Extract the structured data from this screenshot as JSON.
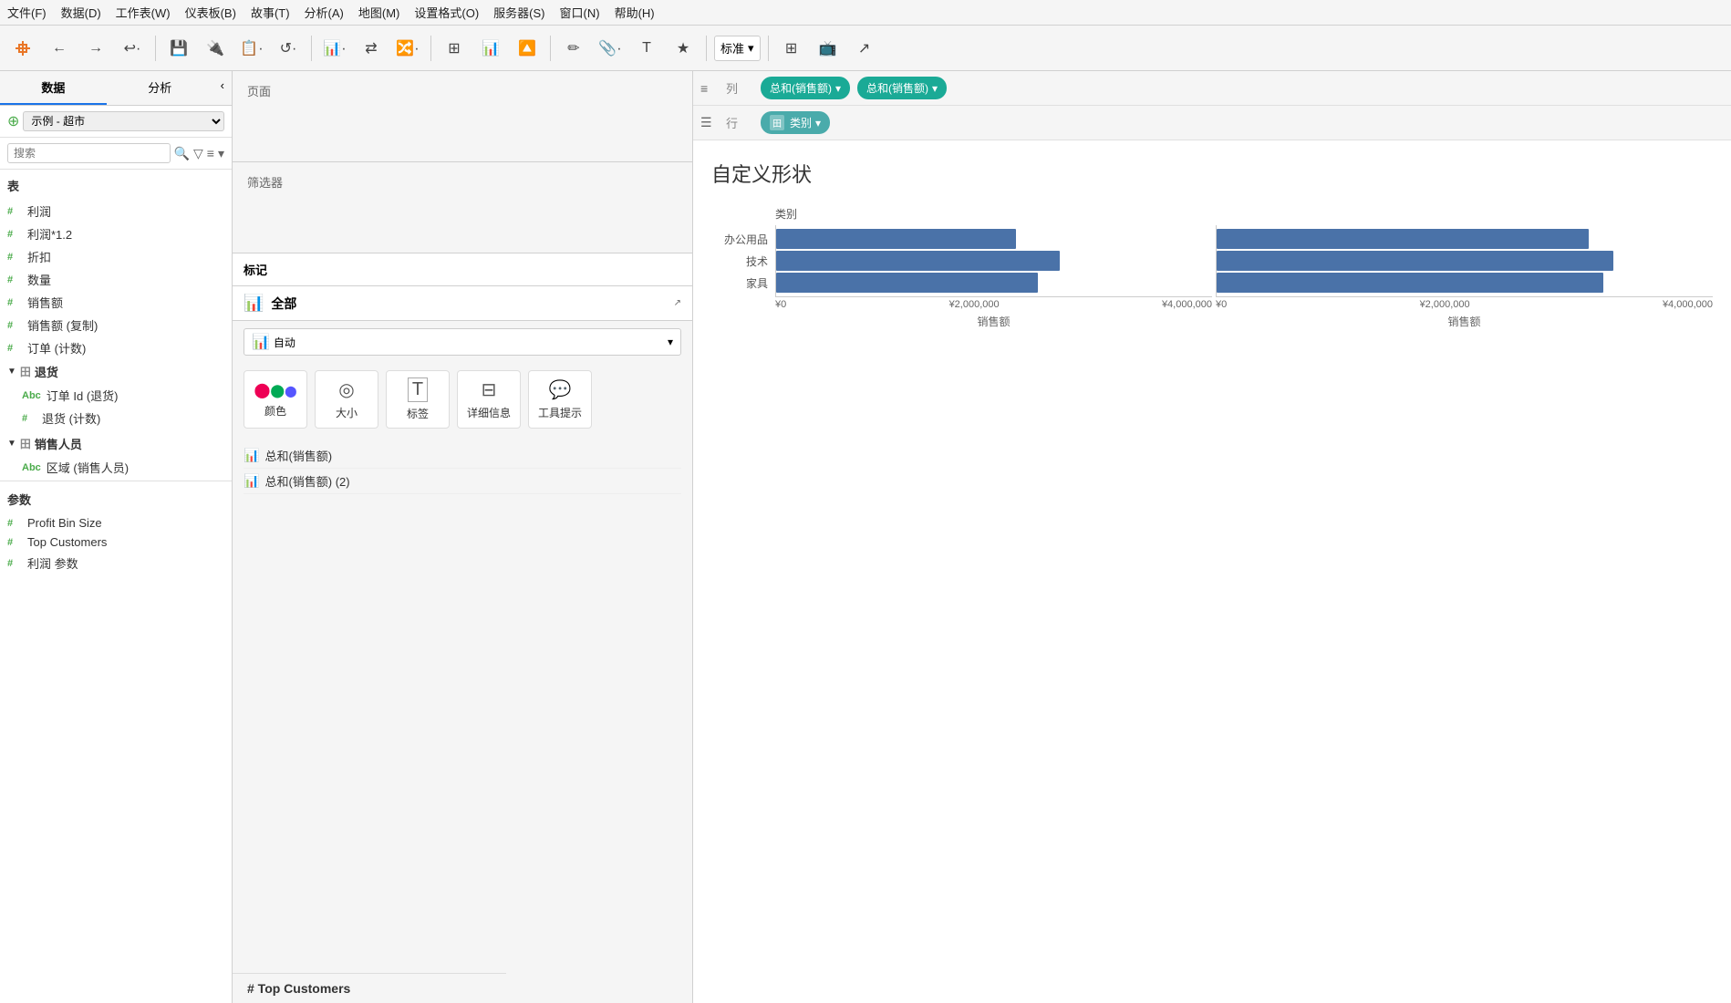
{
  "menuBar": {
    "items": [
      "文件(F)",
      "数据(D)",
      "工作表(W)",
      "仪表板(B)",
      "故事(T)",
      "分析(A)",
      "地图(M)",
      "设置格式(O)",
      "服务器(S)",
      "窗口(N)",
      "帮助(H)"
    ]
  },
  "toolbar": {
    "dropdown_label": "标准",
    "back": "←",
    "forward": "→",
    "redo": "↩",
    "save": "💾",
    "add": "➕",
    "data": "📊"
  },
  "sidebar": {
    "tab1": "数据",
    "tab2": "分析",
    "data_source": "示例 - 超市",
    "search_placeholder": "搜索",
    "section_table": "表",
    "fields": [
      {
        "icon": "#",
        "name": "利润"
      },
      {
        "icon": "#",
        "name": "利润*1.2"
      },
      {
        "icon": "#",
        "name": "折扣"
      },
      {
        "icon": "#",
        "name": "数量"
      },
      {
        "icon": "#",
        "name": "销售额"
      },
      {
        "icon": "#",
        "name": "销售额 (复制)"
      },
      {
        "icon": "#",
        "name": "订单 (计数)"
      }
    ],
    "groups": [
      {
        "icon": "田",
        "name": "退货",
        "fields": [
          {
            "icon": "Abc",
            "name": "订单 Id (退货)"
          },
          {
            "icon": "#",
            "name": "退货 (计数)"
          }
        ]
      },
      {
        "icon": "田",
        "name": "销售人员",
        "fields": [
          {
            "icon": "Abc",
            "name": "区域 (销售人员)"
          }
        ]
      }
    ],
    "param_section": "参数",
    "params": [
      {
        "icon": "#",
        "name": "Profit Bin Size"
      },
      {
        "icon": "#",
        "name": "Top Customers"
      },
      {
        "icon": "#",
        "name": "利润 参数"
      }
    ]
  },
  "middle": {
    "pages_label": "页面",
    "filters_label": "筛选器",
    "marks_label": "标记",
    "marks_type": "自动",
    "marks_all": "全部",
    "marks_cards": [
      {
        "icon": "⬤⬤⬤",
        "label": "颜色"
      },
      {
        "icon": "⊙",
        "label": "大小"
      },
      {
        "icon": "T",
        "label": "标签"
      },
      {
        "icon": "⊡",
        "label": "详细信息"
      },
      {
        "icon": "💬",
        "label": "工具提示"
      }
    ],
    "marks_fields": [
      {
        "icon": "📊",
        "name": "总和(销售额)"
      },
      {
        "icon": "📊",
        "name": "总和(销售额) (2)"
      }
    ]
  },
  "canvas": {
    "columns_label": "列",
    "rows_label": "行",
    "col_pills": [
      "总和(销售额)",
      "总和(销售额)"
    ],
    "row_pills": [
      "类别"
    ],
    "chart_title": "自定义形状",
    "y_label": "类别",
    "categories": [
      "办公用品",
      "技术",
      "家具"
    ],
    "x_labels_left": [
      "¥0",
      "¥2,000,000",
      "¥4,000,000"
    ],
    "x_labels_right": [
      "¥0",
      "¥2,000,000",
      "¥4,000,000"
    ],
    "axis_title": "销售额",
    "bars_left": [
      {
        "category": "办公用品",
        "pct": 55
      },
      {
        "category": "技术",
        "pct": 65
      },
      {
        "category": "家具",
        "pct": 60
      }
    ],
    "bars_right": [
      {
        "category": "办公用品",
        "pct": 75
      },
      {
        "category": "技术",
        "pct": 80
      },
      {
        "category": "家具",
        "pct": 78
      }
    ]
  },
  "bottom": {
    "param_label": "# Top Customers"
  }
}
